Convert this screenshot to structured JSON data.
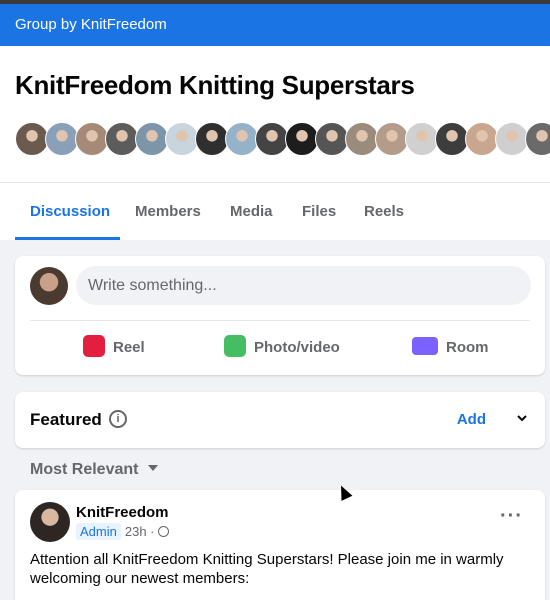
{
  "group_banner": "Group by KnitFreedom",
  "group": {
    "title": "KnitFreedom Knitting Superstars",
    "member_avatar_colors": [
      "#6b5b4e",
      "#8aa0b8",
      "#a58a78",
      "#5c5c5c",
      "#7d95a8",
      "#c8d4de",
      "#2f2f2f",
      "#94b3c9",
      "#444",
      "#1d1d1d",
      "#555",
      "#9b8b7d",
      "#b39d8a",
      "#d0d0d0",
      "#3d3d3d",
      "#c9a78f",
      "#cfcfcf",
      "#6a6a6a"
    ]
  },
  "tabs": [
    "Discussion",
    "Members",
    "Media",
    "Files",
    "Reels"
  ],
  "composer": {
    "placeholder": "Write something...",
    "actions": [
      {
        "label": "Reel",
        "icon": "reel-icon"
      },
      {
        "label": "Photo/video",
        "icon": "photo-video-icon"
      },
      {
        "label": "Room",
        "icon": "room-video-icon"
      }
    ]
  },
  "featured": {
    "label": "Featured",
    "add_label": "Add"
  },
  "sort": {
    "label": "Most Relevant"
  },
  "post": {
    "author": "KnitFreedom",
    "badge": "Admin",
    "time": "23h ·",
    "text": "Attention all KnitFreedom Knitting Superstars! Please join me in warmly welcoming our newest members:"
  },
  "colors": {
    "accent": "#1b74e4",
    "reel": "#e41e3f",
    "photo": "#45bd62",
    "room": "#7b61ff"
  }
}
